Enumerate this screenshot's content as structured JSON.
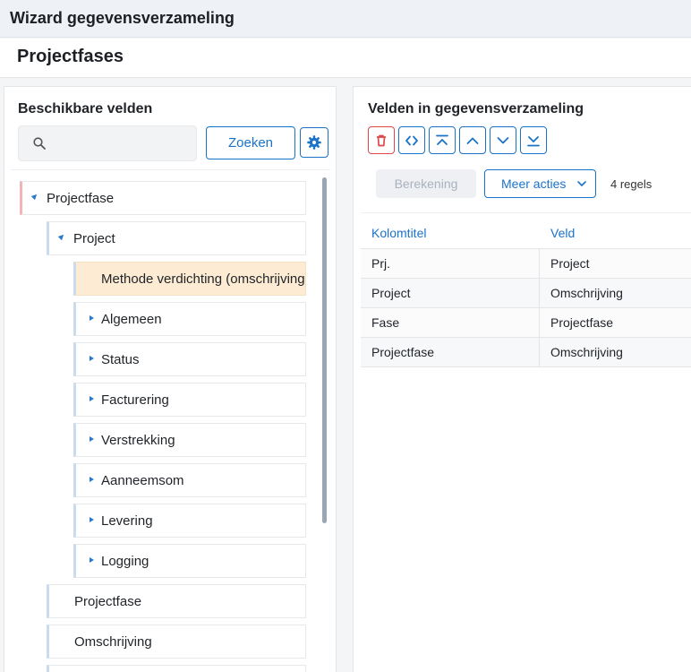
{
  "window": {
    "title": "Wizard gegevensverzameling"
  },
  "page": {
    "title": "Projectfases"
  },
  "left_panel": {
    "heading": "Beschikbare velden",
    "search": {
      "value": "",
      "placeholder": ""
    },
    "search_button": "Zoeken",
    "tree": [
      {
        "label": "Projectfase",
        "level": 0,
        "expanded": true
      },
      {
        "label": "Project",
        "level": 1,
        "expanded": true
      },
      {
        "label": "Methode verdichting (omschrijving)",
        "level": 2,
        "selected": true
      },
      {
        "label": "Algemeen",
        "level": 2,
        "expandable": true
      },
      {
        "label": "Status",
        "level": 2,
        "expandable": true
      },
      {
        "label": "Facturering",
        "level": 2,
        "expandable": true
      },
      {
        "label": "Verstrekking",
        "level": 2,
        "expandable": true
      },
      {
        "label": "Aanneemsom",
        "level": 2,
        "expandable": true
      },
      {
        "label": "Levering",
        "level": 2,
        "expandable": true
      },
      {
        "label": "Logging",
        "level": 2,
        "expandable": true
      },
      {
        "label": "Projectfase",
        "level": 1
      },
      {
        "label": "Omschrijving",
        "level": 1
      },
      {
        "label": "",
        "level": 1
      }
    ]
  },
  "right_panel": {
    "heading": "Velden in gegevensverzameling",
    "toolbar_icons": [
      "trash-icon",
      "code-icon",
      "move-top-icon",
      "move-up-icon",
      "move-down-icon",
      "move-bottom-icon"
    ],
    "calc_button": "Berekening",
    "more_button": "Meer acties",
    "row_count": "4 regels",
    "table": {
      "columns": [
        "Kolomtitel",
        "Veld"
      ],
      "rows": [
        [
          "Prj.",
          "Project"
        ],
        [
          "Project",
          "Omschrijving"
        ],
        [
          "Fase",
          "Projectfase"
        ],
        [
          "Projectfase",
          "Omschrijving"
        ]
      ]
    }
  },
  "colors": {
    "accent": "#1a73c8",
    "danger": "#e04848",
    "selected_bg": "#fdecd3"
  }
}
